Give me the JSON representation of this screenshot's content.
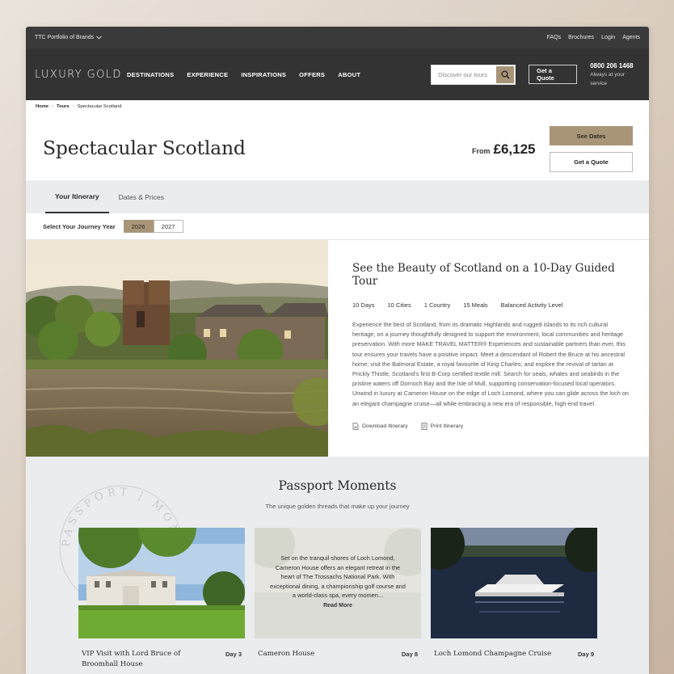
{
  "topbar": {
    "brands_label": "TTC Portfolio of Brands",
    "links": [
      "FAQs",
      "Brochures",
      "Login",
      "Agents"
    ]
  },
  "nav": {
    "logo": "LUXURY GOLD",
    "items": [
      "DESTINATIONS",
      "EXPERIENCE",
      "INSPIRATIONS",
      "OFFERS",
      "ABOUT"
    ],
    "search_placeholder": "Discover our tours",
    "quote_label": "Get a Quote",
    "phone": "0800 206 1468",
    "phone_sub": "Always at your service"
  },
  "breadcrumb": [
    "Home",
    "Tours",
    "Spectacular Scotland"
  ],
  "tour": {
    "title": "Spectacular Scotland",
    "price_from": "From",
    "price": "£6,125",
    "see_dates": "See Dates",
    "get_quote": "Get a Quote"
  },
  "tabs": [
    "Your Itinerary",
    "Dates & Prices"
  ],
  "year_select": {
    "label": "Select Your Journey Year",
    "years": [
      "2026",
      "2027"
    ],
    "selected": "2026"
  },
  "overview": {
    "heading": "See the Beauty of Scotland on a 10-Day Guided Tour",
    "facts": [
      "10 Days",
      "10 Cities",
      "1 Country",
      "15 Meals",
      "Balanced Activity Level"
    ],
    "description": "Experience the best of Scotland, from its dramatic Highlands and rugged islands to its rich cultural heritage, on a journey thoughtfully designed to support the environment, local communities and heritage preservation. With more MAKE TRAVEL MATTER® Experiences and sustainable partners than ever, this tour ensures your travels have a positive impact. Meet a descendant of Robert the Bruce at his ancestral home; visit the Balmoral Estate, a royal favourite of King Charles; and explore the revival of tartan at Prickly Thistle, Scotland's first B-Corp certified textile mill. Search for seals, whales and seabirds in the pristine waters off Dornoch Bay and the Isle of Mull, supporting conservation-focused local operators. Unwind in luxury at Cameron House on the edge of Loch Lomond, where you can glide across the loch on an elegant champagne cruise—all while embracing a new era of responsible, high-end travel.",
    "download_label": "Download Itinerary",
    "print_label": "Print Itinerary"
  },
  "passport": {
    "heading": "Passport Moments",
    "subheading": "The unique golden threads that make up your journey",
    "stamp_text": "PASSPORT | MOMENTS",
    "cards": [
      {
        "name": "VIP Visit with Lord Bruce of Broomhall House",
        "day": "Day 3"
      },
      {
        "name": "Cameron House",
        "day": "Day 8",
        "overlay": "Set on the tranquil shores of Loch Lomond, Cameron House offers an elegant retreat in the heart of The Trossachs National Park. With exceptional dining, a championship golf course and a world-class spa, every momen...",
        "read_more": "Read More"
      },
      {
        "name": "Loch Lomond Champagne Cruise",
        "day": "Day 9"
      }
    ]
  },
  "colors": {
    "accent": "#a99678",
    "nav_bg": "#333333",
    "topbar_bg": "#3a3a3a",
    "section_bg": "#ebecee"
  }
}
